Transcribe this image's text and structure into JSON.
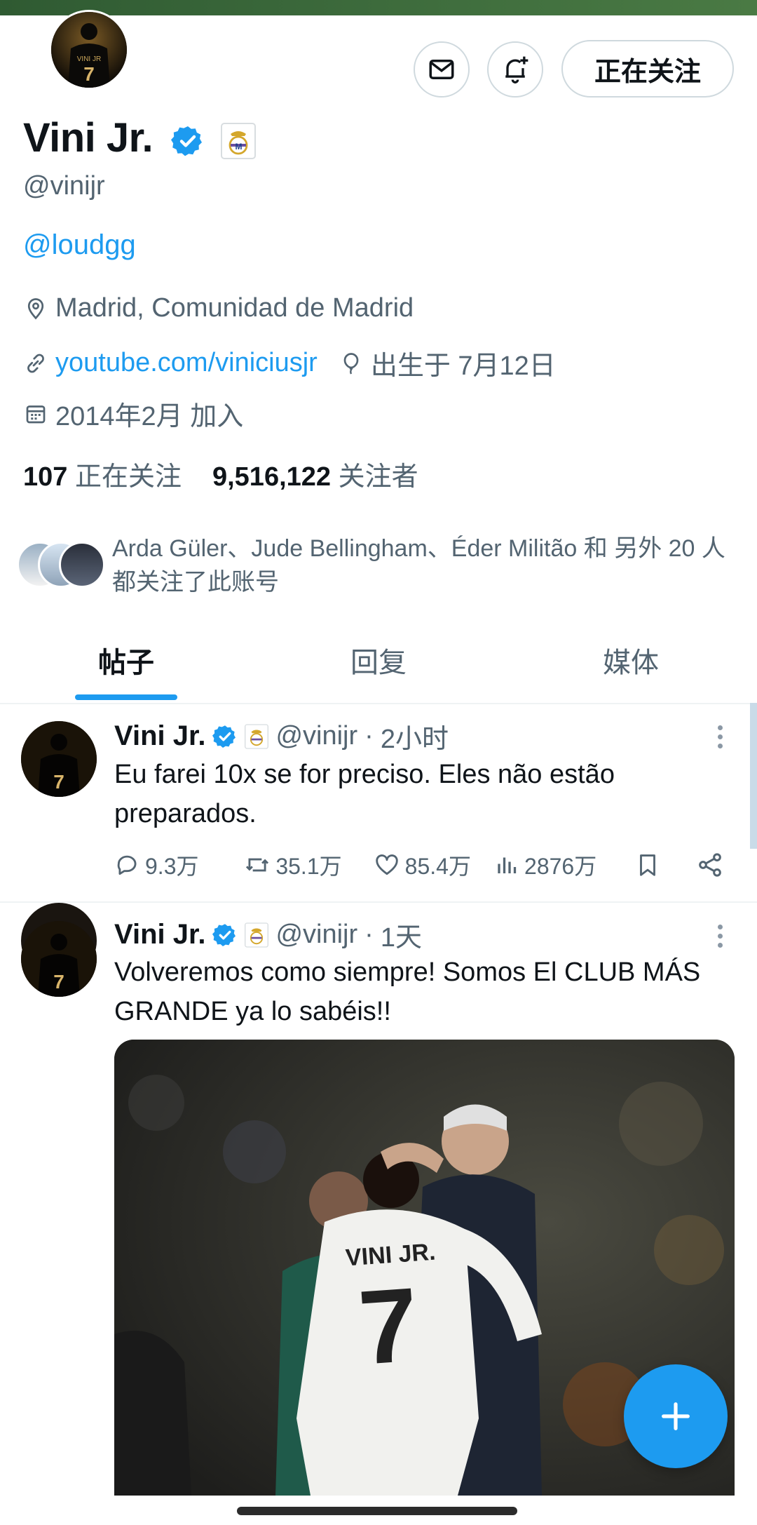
{
  "profile": {
    "name": "Vini Jr.",
    "handle": "@vinijr",
    "bio_link": "@loudgg",
    "location": "Madrid, Comunidad de Madrid",
    "website": "youtube.com/viniciusjr",
    "birthday": "出生于 7月12日",
    "joined": "2014年2月 加入",
    "following_count": "107",
    "following_label": "正在关注",
    "followers_count": "9,516,122",
    "followers_label": "关注者",
    "mutual_text": "Arda Güler、Jude Bellingham、Éder Militão 和 另外 20 人 都关注了此账号",
    "follow_button": "正在关注",
    "avatar_jersey": "VINI JR",
    "avatar_number": "7"
  },
  "tabs": [
    {
      "label": "帖子",
      "active": true
    },
    {
      "label": "回复",
      "active": false
    },
    {
      "label": "媒体",
      "active": false
    }
  ],
  "tweets": [
    {
      "name": "Vini Jr.",
      "handle": "@vinijr",
      "sep": "·",
      "time": "2小时",
      "text": "Eu farei 10x se for preciso. Eles não estão preparados.",
      "replies": "9.3万",
      "retweets": "35.1万",
      "likes": "85.4万",
      "views": "2876万"
    },
    {
      "name": "Vini Jr.",
      "handle": "@vinijr",
      "sep": "·",
      "time": "1天",
      "text": "Volveremos como siempre! Somos El CLUB MÁS GRANDE ya lo sabéis!!",
      "photo_jersey_name": "VINI JR.",
      "photo_jersey_number": "7"
    }
  ],
  "colors": {
    "accent": "#1d9bf0",
    "text_primary": "#0f1419",
    "text_secondary": "#536471",
    "border": "#cfd9de",
    "verified": "#1d9bf0"
  },
  "icons": {
    "message": "envelope-icon",
    "notify": "bell-plus-icon",
    "location": "location-pin-icon",
    "link": "link-icon",
    "birthday": "balloon-icon",
    "joined": "calendar-icon",
    "fab": "plus-icon"
  }
}
